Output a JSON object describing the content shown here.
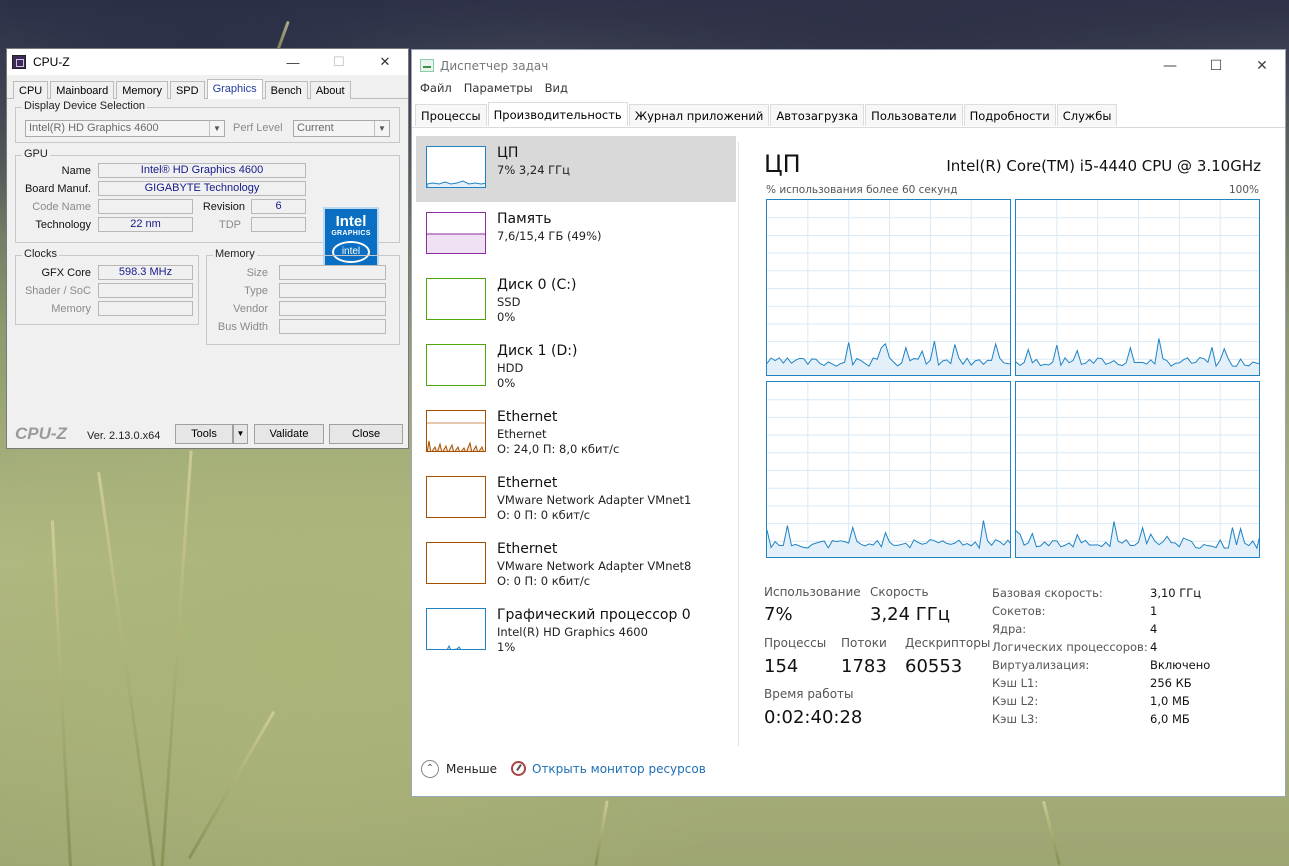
{
  "cpuz": {
    "title": "CPU-Z",
    "tabs": [
      "CPU",
      "Mainboard",
      "Memory",
      "SPD",
      "Graphics",
      "Bench",
      "About"
    ],
    "active_tab": "Graphics",
    "display_device_selection": {
      "group": "Display Device Selection",
      "device": "Intel(R) HD Graphics 4600",
      "perf_level_label": "Perf Level",
      "perf_level": "Current"
    },
    "gpu": {
      "group": "GPU",
      "name_label": "Name",
      "name": "Intel® HD Graphics 4600",
      "board_label": "Board Manuf.",
      "board": "GIGABYTE Technology",
      "code_label": "Code Name",
      "code": "",
      "revision_label": "Revision",
      "revision": "6",
      "tech_label": "Technology",
      "tech": "22 nm",
      "tdp_label": "TDP",
      "tdp": ""
    },
    "intel_logo": {
      "brand": "Intel",
      "line": "GRAPHICS",
      "badge": "intel"
    },
    "clocks": {
      "group": "Clocks",
      "gfx_label": "GFX Core",
      "gfx": "598.3 MHz",
      "shader_label": "Shader / SoC",
      "shader": "",
      "memory_label": "Memory",
      "memory": ""
    },
    "memory": {
      "group": "Memory",
      "size_label": "Size",
      "type_label": "Type",
      "vendor_label": "Vendor",
      "bus_label": "Bus Width"
    },
    "footer": {
      "brand": "CPU-Z",
      "version": "Ver. 2.13.0.x64",
      "tools": "Tools",
      "validate": "Validate",
      "close": "Close"
    }
  },
  "taskmgr": {
    "title": "Диспетчер задач",
    "menu": [
      "Файл",
      "Параметры",
      "Вид"
    ],
    "tabs": [
      "Процессы",
      "Производительность",
      "Журнал приложений",
      "Автозагрузка",
      "Пользователи",
      "Подробности",
      "Службы"
    ],
    "active_tab": "Производительность",
    "sidebar": [
      {
        "name": "ЦП",
        "sub": "7% 3,24 ГГц",
        "sub2": "",
        "color": "#1f83c4"
      },
      {
        "name": "Память",
        "sub": "7,6/15,4 ГБ (49%)",
        "sub2": "",
        "color": "#8b2fa0"
      },
      {
        "name": "Диск 0 (C:)",
        "sub": "SSD",
        "sub2": "0%",
        "color": "#4da60c"
      },
      {
        "name": "Диск 1 (D:)",
        "sub": "HDD",
        "sub2": "0%",
        "color": "#4da60c"
      },
      {
        "name": "Ethernet",
        "sub": "Ethernet",
        "sub2": "О: 24,0 П: 8,0 кбит/с",
        "color": "#a74f01"
      },
      {
        "name": "Ethernet",
        "sub": "VMware Network Adapter VMnet1",
        "sub2": "О: 0 П: 0 кбит/с",
        "color": "#a74f01"
      },
      {
        "name": "Ethernet",
        "sub": "VMware Network Adapter VMnet8",
        "sub2": "О: 0 П: 0 кбит/с",
        "color": "#a74f01"
      },
      {
        "name": "Графический процессор 0",
        "sub": "Intel(R) HD Graphics 4600",
        "sub2": "1%",
        "color": "#1f83c4"
      }
    ],
    "cpu": {
      "title": "ЦП",
      "model": "Intel(R) Core(TM) i5-4440 CPU @ 3.10GHz",
      "axis_left": "% использования более 60 секунд",
      "axis_right": "100%",
      "usage_label": "Использование",
      "usage": "7%",
      "speed_label": "Скорость",
      "speed": "3,24 ГГц",
      "processes_label": "Процессы",
      "processes": "154",
      "threads_label": "Потоки",
      "threads": "1783",
      "handles_label": "Дескрипторы",
      "handles": "60553",
      "uptime_label": "Время работы",
      "uptime": "0:02:40:28",
      "details": [
        {
          "k": "Базовая скорость:",
          "v": "3,10 ГГц"
        },
        {
          "k": "Сокетов:",
          "v": "1"
        },
        {
          "k": "Ядра:",
          "v": "4"
        },
        {
          "k": "Логических процессоров:",
          "v": "4"
        },
        {
          "k": "Виртуализация:",
          "v": "Включено"
        },
        {
          "k": "Кэш L1:",
          "v": "256 КБ"
        },
        {
          "k": "Кэш L2:",
          "v": "1,0 МБ"
        },
        {
          "k": "Кэш L3:",
          "v": "6,0 МБ"
        }
      ]
    },
    "footer": {
      "fewer": "Меньше",
      "resmon": "Открыть монитор ресурсов"
    }
  }
}
